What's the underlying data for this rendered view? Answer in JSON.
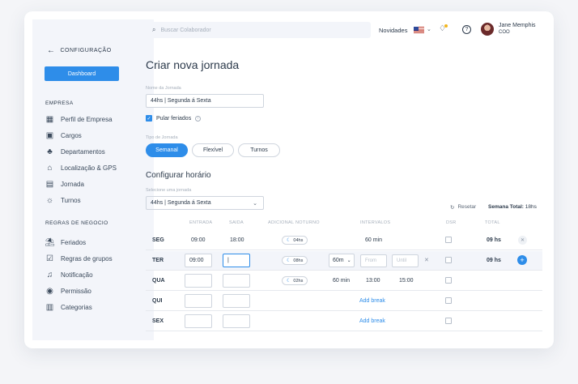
{
  "sidebar": {
    "back_label": "CONFIGURAÇÃO",
    "dashboard_label": "Dashboard",
    "section_empresa": "EMPRESA",
    "empresa_items": [
      "Perfil de Empresa",
      "Cargos",
      "Departamentos",
      "Localização & GPS",
      "Jornada",
      "Turnos"
    ],
    "section_regras": "REGRAS DE NEGOCIO",
    "regras_items": [
      "Feriados",
      "Regras de grupos",
      "Notificação",
      "Permissão",
      "Categorias"
    ]
  },
  "topbar": {
    "search_placeholder": "Buscar Colaborador",
    "novidades": "Novidades",
    "user_name": "Jane Memphis",
    "user_role": "COO"
  },
  "form": {
    "title": "Criar nova jornada",
    "name_label": "Nome da Jornada",
    "name_value": "44hs | Segunda á Sexta",
    "pular_label": "Pular feriados",
    "tipo_label": "Tipo de Jornada",
    "tipos": [
      "Semanal",
      "Flexível",
      "Turnos"
    ],
    "config_title": "Configurar horário",
    "select_label": "Selecione uma jornada",
    "select_value": "44hs | Segunda á Sexta",
    "reset_label": "Resetar",
    "semana_total_label": "Semana Total:",
    "semana_total_value": "18hs"
  },
  "table": {
    "headers": [
      "ENTRADA",
      "SAIDA",
      "ADICIONAL NOTURNO",
      "INTERVALOS",
      "DSR",
      "TOTAL"
    ],
    "rows": [
      {
        "day": "SEG",
        "entrada": "09:00",
        "saida": "18:00",
        "noturno": "04hs",
        "intervalo": "60 min",
        "total": "09 hs"
      },
      {
        "day": "TER",
        "entrada": "09:00",
        "saida": "|",
        "noturno": "08hs",
        "intervalo_sel": "60m",
        "from": "From",
        "until": "Until",
        "total": "09 hs"
      },
      {
        "day": "QUA",
        "noturno": "02hs",
        "intervalo": "60 min",
        "from": "13:00",
        "until": "15:00"
      },
      {
        "day": "QUI",
        "add_break": "Add break"
      },
      {
        "day": "SEX",
        "add_break": "Add break"
      }
    ]
  }
}
